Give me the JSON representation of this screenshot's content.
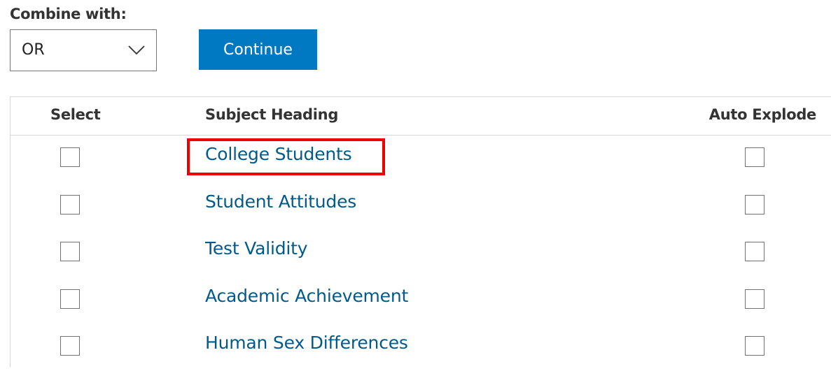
{
  "combine": {
    "label": "Combine with:",
    "selected": "OR",
    "icon": "chevron-down-icon"
  },
  "continue_label": "Continue",
  "colors": {
    "button_bg": "#0079c2",
    "link": "#005a8c",
    "highlight": "#ee0000"
  },
  "table": {
    "headers": {
      "select": "Select",
      "subject": "Subject Heading",
      "auto_explode": "Auto Explode"
    },
    "rows": [
      {
        "heading": "College Students",
        "selected": false,
        "auto_explode": false,
        "highlighted": true
      },
      {
        "heading": "Student Attitudes",
        "selected": false,
        "auto_explode": false,
        "highlighted": false
      },
      {
        "heading": "Test Validity",
        "selected": false,
        "auto_explode": false,
        "highlighted": false
      },
      {
        "heading": "Academic Achievement",
        "selected": false,
        "auto_explode": false,
        "highlighted": false
      },
      {
        "heading": "Human Sex Differences",
        "selected": false,
        "auto_explode": false,
        "highlighted": false
      }
    ]
  }
}
